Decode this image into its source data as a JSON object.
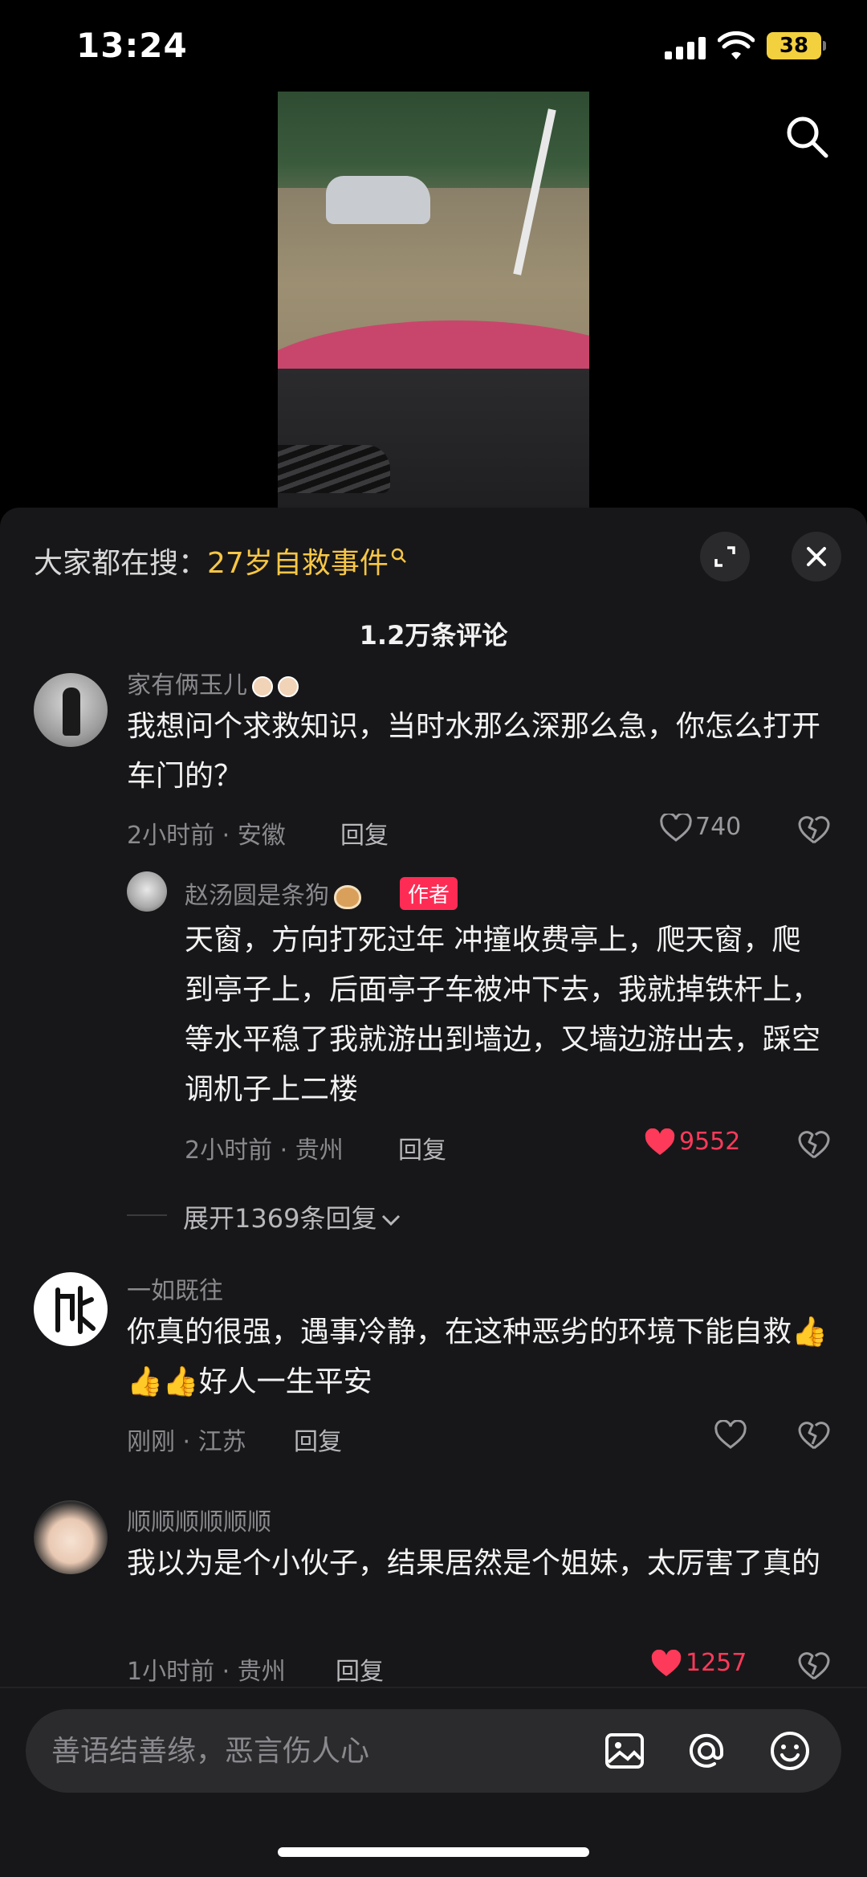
{
  "status": {
    "time": "13:24",
    "battery": "38"
  },
  "sheet": {
    "trend_prefix": "大家都在搜：",
    "trend_query": "27岁自救事件",
    "comment_count": "1.2万条评论"
  },
  "comments": [
    {
      "user": "家有俩玉儿",
      "text": "我想问个求救知识，当时水那么深那么急，你怎么打开车门的？",
      "meta": "2小时前 · 安徽",
      "reply_label": "回复",
      "likes": "740"
    },
    {
      "user": "赵汤圆是条狗",
      "badge": "作者",
      "text": "天窗，方向打死过年 冲撞收费亭上，爬天窗，爬到亭子上，后面亭子车被冲下去，我就掉铁杆上，等水平稳了我就游出到墙边，又墙边游出去，踩空调机子上二楼",
      "meta": "2小时前 · 贵州",
      "reply_label": "回复",
      "likes": "9552"
    },
    {
      "expand_label": "展开1369条回复"
    },
    {
      "user": "一如既往",
      "text": "你真的很强，遇事冷静，在这种恶劣的环境下能自救👍👍👍好人一生平安",
      "meta": "刚刚 · 江苏",
      "reply_label": "回复"
    },
    {
      "user": "顺顺顺顺顺顺",
      "text": "我以为是个小伙子，结果居然是个姐妹，太厉害了真的",
      "meta": "1小时前 · 贵州",
      "reply_label": "回复",
      "likes": "1257"
    }
  ],
  "input": {
    "placeholder": "善语结善缘，恶言伤人心"
  },
  "icons": [
    "search-icon",
    "expand-icon",
    "close-icon",
    "heart-icon",
    "dislike-icon",
    "image-icon",
    "at-icon",
    "emoji-icon"
  ],
  "colors": {
    "accent": "#fe2c55",
    "highlight": "#f7c646",
    "sheet": "#171719"
  }
}
